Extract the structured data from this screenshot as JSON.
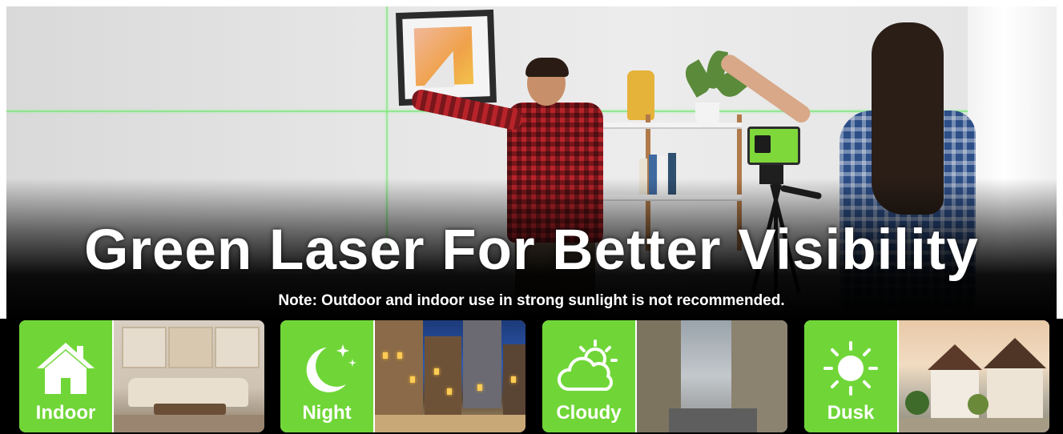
{
  "hero": {
    "headline": "Green Laser For Better Visibility",
    "note": "Note: Outdoor and indoor use in strong sunlight is not recommended."
  },
  "cards": [
    {
      "label": "Indoor",
      "icon": "house-icon"
    },
    {
      "label": "Night",
      "icon": "moon-stars-icon"
    },
    {
      "label": "Cloudy",
      "icon": "cloud-sun-icon"
    },
    {
      "label": "Dusk",
      "icon": "sun-icon"
    }
  ],
  "colors": {
    "accent_green": "#70d638",
    "laser_green": "#78e678",
    "text": "#ffffff",
    "background_band": "#000000"
  }
}
